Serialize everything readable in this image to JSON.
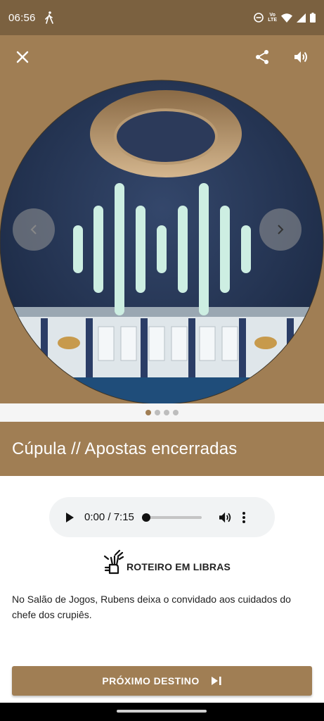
{
  "status_bar": {
    "time": "06:56",
    "network_label_top": "Vo",
    "network_label_bottom": "LTE"
  },
  "app_bar": {
    "close_icon": "close-icon",
    "share_icon": "share-icon",
    "volume_icon": "volume-icon"
  },
  "carousel": {
    "slide_count": 4,
    "active_index": 0
  },
  "title": "Cúpula // Apostas encerradas",
  "audio_player": {
    "time_display": "0:00 / 7:15",
    "progress": 0
  },
  "libras": {
    "label": "ROTEIRO EM LIBRAS"
  },
  "description": "No Salão de Jogos, Rubens deixa o convidado aos cuidados do chefe dos crupiês.",
  "next_button": {
    "label": "PRÓXIMO DESTINO"
  },
  "colors": {
    "brand": "#a07e54",
    "status_bar": "#7b6140",
    "wave": "#cdeee2"
  }
}
